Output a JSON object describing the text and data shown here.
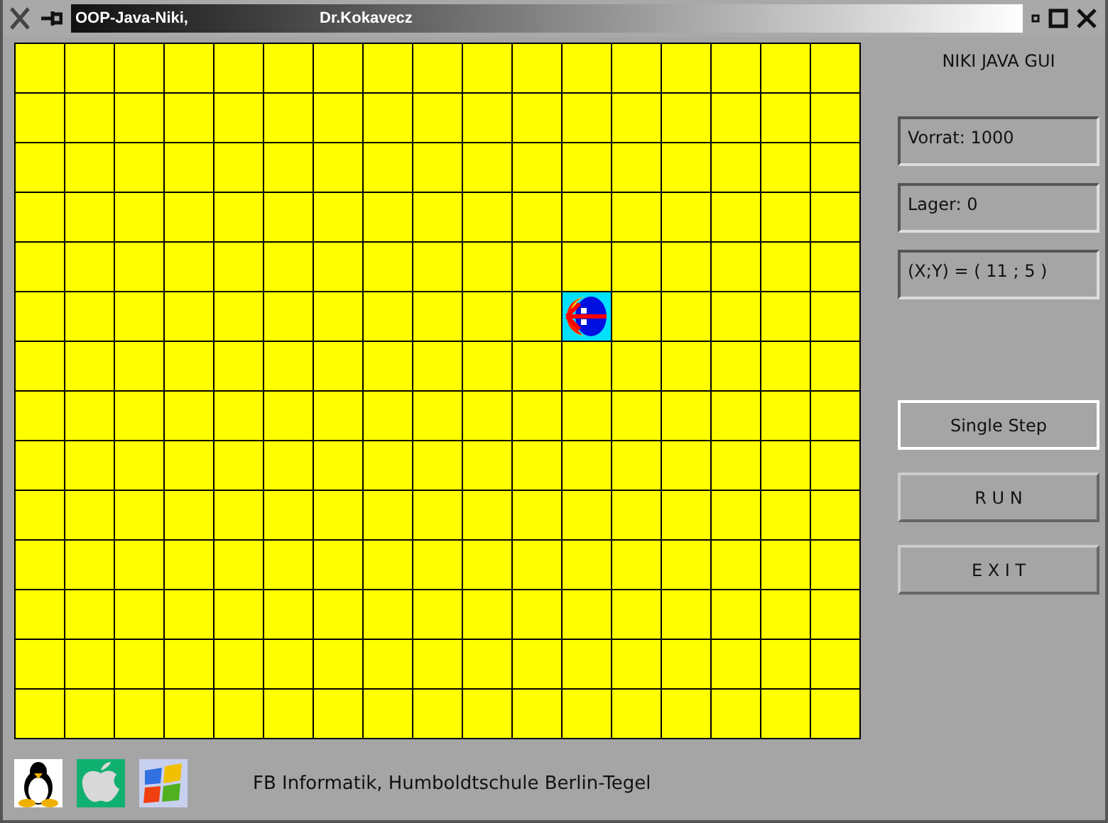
{
  "window": {
    "title": "OOP-Java-Niki,",
    "author": "Dr.Kokavecz"
  },
  "grid": {
    "robot": [
      [
        false,
        false,
        false,
        false,
        false,
        false,
        false,
        false,
        false,
        false,
        false,
        false,
        false,
        false,
        false,
        false,
        false
      ],
      [
        false,
        false,
        false,
        false,
        false,
        false,
        false,
        false,
        false,
        false,
        false,
        false,
        false,
        false,
        false,
        false,
        false
      ],
      [
        false,
        false,
        false,
        false,
        false,
        false,
        false,
        false,
        false,
        false,
        false,
        false,
        false,
        false,
        false,
        false,
        false
      ],
      [
        false,
        false,
        false,
        false,
        false,
        false,
        false,
        false,
        false,
        false,
        false,
        false,
        false,
        false,
        false,
        false,
        false
      ],
      [
        false,
        false,
        false,
        false,
        false,
        false,
        false,
        false,
        false,
        false,
        false,
        false,
        false,
        false,
        false,
        false,
        false
      ],
      [
        false,
        false,
        false,
        false,
        false,
        false,
        false,
        false,
        false,
        false,
        false,
        true,
        false,
        false,
        false,
        false,
        false
      ],
      [
        false,
        false,
        false,
        false,
        false,
        false,
        false,
        false,
        false,
        false,
        false,
        false,
        false,
        false,
        false,
        false,
        false
      ],
      [
        false,
        false,
        false,
        false,
        false,
        false,
        false,
        false,
        false,
        false,
        false,
        false,
        false,
        false,
        false,
        false,
        false
      ],
      [
        false,
        false,
        false,
        false,
        false,
        false,
        false,
        false,
        false,
        false,
        false,
        false,
        false,
        false,
        false,
        false,
        false
      ],
      [
        false,
        false,
        false,
        false,
        false,
        false,
        false,
        false,
        false,
        false,
        false,
        false,
        false,
        false,
        false,
        false,
        false
      ],
      [
        false,
        false,
        false,
        false,
        false,
        false,
        false,
        false,
        false,
        false,
        false,
        false,
        false,
        false,
        false,
        false,
        false
      ],
      [
        false,
        false,
        false,
        false,
        false,
        false,
        false,
        false,
        false,
        false,
        false,
        false,
        false,
        false,
        false,
        false,
        false
      ],
      [
        false,
        false,
        false,
        false,
        false,
        false,
        false,
        false,
        false,
        false,
        false,
        false,
        false,
        false,
        false,
        false,
        false
      ],
      [
        false,
        false,
        false,
        false,
        false,
        false,
        false,
        false,
        false,
        false,
        false,
        false,
        false,
        false,
        false,
        false,
        false
      ]
    ]
  },
  "panel": {
    "heading": "NIKI JAVA GUI",
    "fields": [
      {
        "value": "Vorrat: 1000"
      },
      {
        "value": "Lager: 0"
      },
      {
        "value": "(X;Y) = ( 11 ; 5 )"
      }
    ],
    "buttons": [
      {
        "label": "Single Step",
        "focused": true
      },
      {
        "label": "R U N",
        "focused": false
      },
      {
        "label": "E X I T",
        "focused": false
      }
    ]
  },
  "footer": {
    "text": "FB Informatik, Humboldtschule Berlin-Tegel"
  }
}
